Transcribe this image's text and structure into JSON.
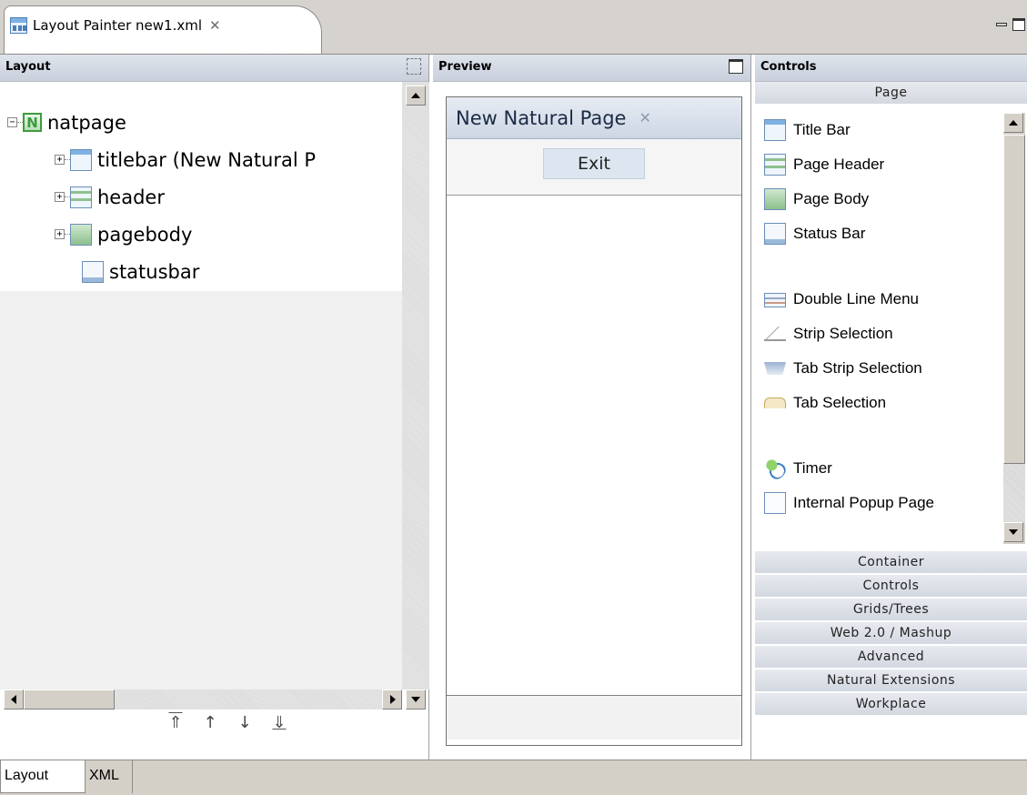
{
  "editor": {
    "tab_title": "Layout Painter new1.xml",
    "tab_close": "✕"
  },
  "layout_pane": {
    "title": "Layout",
    "tree": [
      {
        "label": "natpage",
        "icon": "natpage-icon",
        "expander": "−",
        "level": 0
      },
      {
        "label": "titlebar (New Natural P",
        "icon": "titlebar-icon",
        "expander": "+",
        "level": 1
      },
      {
        "label": "header",
        "icon": "header-icon",
        "expander": "+",
        "level": 1
      },
      {
        "label": "pagebody",
        "icon": "pagebody-icon",
        "expander": "+",
        "level": 1
      },
      {
        "label": "statusbar",
        "icon": "statusbar-icon",
        "expander": "",
        "level": 1
      }
    ],
    "natpage_badge": "N",
    "move_buttons": {
      "first": "⇑",
      "up": "↑",
      "down": "↓",
      "last": "⇓"
    }
  },
  "preview_pane": {
    "title": "Preview",
    "page_title": "New Natural Page",
    "page_close": "✕",
    "exit_button": "Exit"
  },
  "controls_pane": {
    "title": "Controls",
    "active_group": "Page",
    "page_items_1": [
      "Title Bar",
      "Page Header",
      "Page Body",
      "Status Bar"
    ],
    "page_items_2": [
      "Double Line Menu",
      "Strip Selection",
      "Tab Strip Selection",
      "Tab Selection"
    ],
    "page_items_3": [
      "Timer",
      "Internal Popup Page"
    ],
    "groups": [
      "Container",
      "Controls",
      "Grids/Trees",
      "Web 2.0 / Mashup",
      "Advanced",
      "Natural Extensions",
      "Workplace"
    ]
  },
  "bottom_tabs": {
    "layout": "Layout",
    "xml": "XML"
  }
}
